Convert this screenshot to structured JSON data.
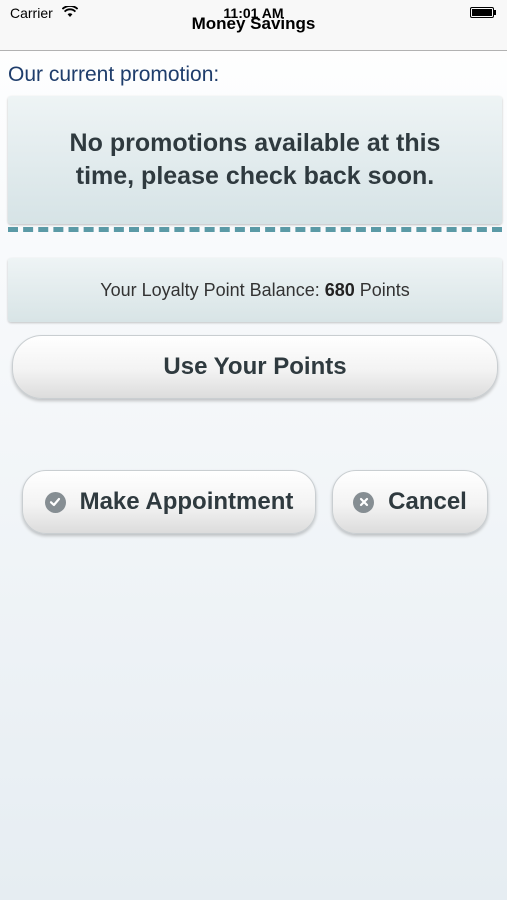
{
  "status_bar": {
    "carrier": "Carrier",
    "time": "11:01 AM"
  },
  "nav": {
    "title": "Money Savings"
  },
  "promotion": {
    "heading": "Our current promotion:",
    "message": "No promotions available at this time, please check back soon."
  },
  "loyalty": {
    "prefix": "Your Loyalty Point Balance:",
    "value": "680",
    "unit": "Points"
  },
  "buttons": {
    "use_points": "Use Your Points",
    "make_appointment": "Make Appointment",
    "cancel": "Cancel"
  },
  "icons": {
    "make_appointment": "check-circle-icon",
    "cancel": "close-circle-icon"
  },
  "colors": {
    "heading": "#1e3d6b",
    "divider": "#5b9aa6",
    "button_text": "#2f3a3f"
  }
}
